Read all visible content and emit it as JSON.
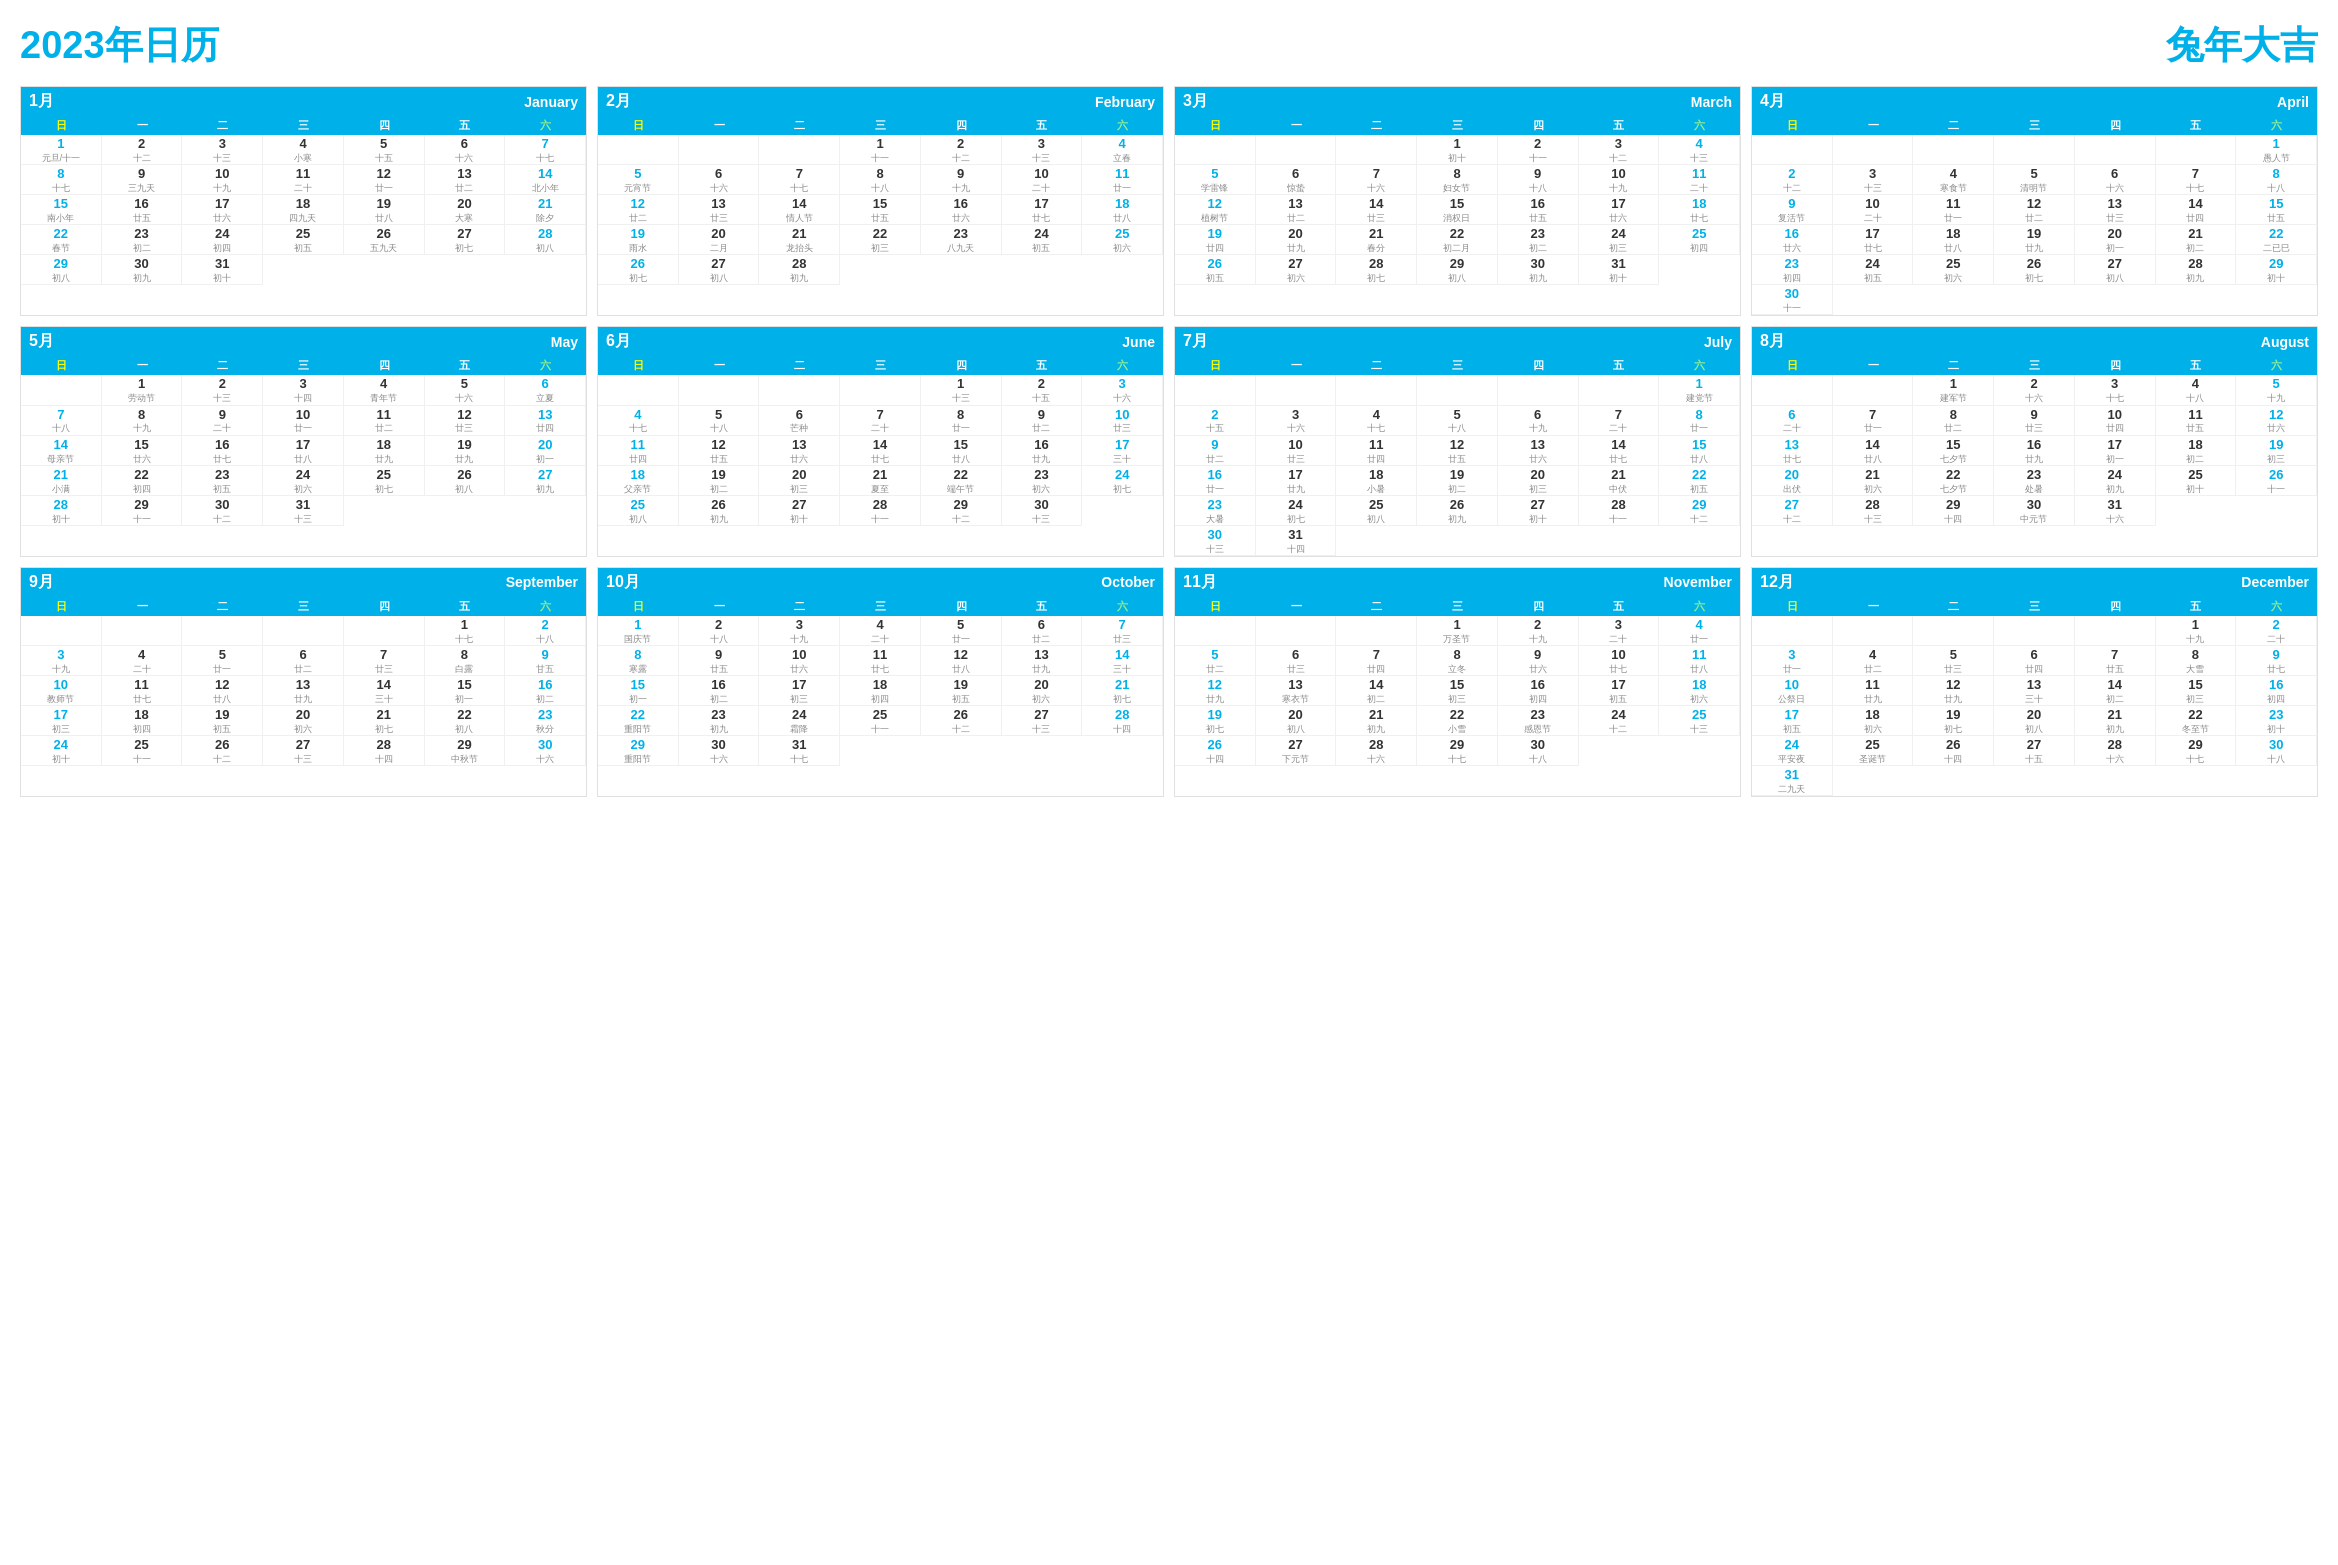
{
  "header": {
    "title": "2023年日历",
    "subtitle": "兔年大吉"
  },
  "weekdays": [
    "日",
    "一",
    "二",
    "三",
    "四",
    "五",
    "六"
  ],
  "months": [
    {
      "cn": "1月",
      "en": "January",
      "startDay": 0,
      "days": 31,
      "lunar": {
        "1": "元旦/十一",
        "2": "十二",
        "3": "十三",
        "4": "小寒",
        "5": "十五",
        "6": "十六",
        "7": "十七",
        "8": "十七",
        "9": "三九天",
        "10": "十九",
        "11": "二十",
        "12": "廿一",
        "13": "廿二",
        "14": "北小年",
        "15": "南小年",
        "16": "廿五",
        "17": "廿六",
        "18": "四九天",
        "19": "廿八",
        "20": "大寒",
        "21": "除夕",
        "22": "春节",
        "23": "初二",
        "24": "初四",
        "25": "初五",
        "26": "五九天",
        "27": "初七",
        "28": "初八",
        "29": "初八",
        "30": "初九",
        "31": "初十"
      },
      "sundays": [
        1,
        8,
        15,
        22,
        29
      ],
      "saturdays": [
        7,
        14,
        21,
        28
      ]
    },
    {
      "cn": "2月",
      "en": "February",
      "startDay": 3,
      "days": 28,
      "lunar": {
        "1": "十一",
        "2": "十二",
        "3": "十三",
        "4": "立春",
        "5": "元宵节",
        "6": "十六",
        "7": "十七",
        "8": "十八",
        "9": "十九",
        "10": "二十",
        "11": "廿一",
        "12": "廿二",
        "13": "廿三",
        "14": "情人节",
        "15": "廿五",
        "16": "廿六",
        "17": "廿七",
        "18": "廿八",
        "19": "雨水",
        "20": "二月",
        "21": "龙抬头",
        "22": "初三",
        "23": "八九天",
        "24": "初五",
        "25": "初六",
        "26": "初七",
        "27": "初八",
        "28": "初九"
      },
      "sundays": [
        5,
        12,
        19,
        26
      ],
      "saturdays": [
        4,
        11,
        18,
        25
      ]
    },
    {
      "cn": "3月",
      "en": "March",
      "startDay": 3,
      "days": 31,
      "lunar": {
        "1": "初十",
        "2": "十一",
        "3": "十二",
        "4": "十三",
        "5": "学雷锋",
        "6": "惊蛰",
        "7": "十六",
        "8": "妇女节",
        "9": "十八",
        "10": "十九",
        "11": "二十",
        "12": "植树节",
        "13": "廿二",
        "14": "廿三",
        "15": "消权日",
        "16": "廿五",
        "17": "廿六",
        "18": "廿七",
        "19": "廿四",
        "20": "廿九",
        "21": "春分",
        "22": "初二月",
        "23": "初二",
        "24": "初三",
        "25": "初四",
        "26": "初五",
        "27": "初六",
        "28": "初七",
        "29": "初八",
        "30": "初九",
        "31": "初十"
      },
      "sundays": [
        5,
        12,
        19,
        26
      ],
      "saturdays": [
        4,
        11,
        18,
        25
      ]
    },
    {
      "cn": "4月",
      "en": "April",
      "startDay": 6,
      "days": 30,
      "lunar": {
        "1": "愚人节",
        "2": "十二",
        "3": "十三",
        "4": "寒食节",
        "5": "清明节",
        "6": "十六",
        "7": "十七",
        "8": "十八",
        "9": "复活节",
        "10": "二十",
        "11": "廿一",
        "12": "廿二",
        "13": "廿三",
        "14": "廿四",
        "15": "廿五",
        "16": "廿六",
        "17": "廿七",
        "18": "廿八",
        "19": "廿九",
        "20": "初一",
        "21": "初二",
        "22": "二已巳",
        "23": "初四",
        "24": "初五",
        "25": "初六",
        "26": "初七",
        "27": "初八",
        "28": "初九",
        "29": "初十",
        "30": "十一"
      },
      "sundays": [
        2,
        9,
        16,
        23,
        30
      ],
      "saturdays": [
        1,
        8,
        15,
        22,
        29
      ]
    },
    {
      "cn": "5月",
      "en": "May",
      "startDay": 1,
      "days": 31,
      "lunar": {
        "1": "劳动节",
        "2": "十三",
        "3": "十四",
        "4": "青年节",
        "5": "十六",
        "6": "立夏",
        "7": "十八",
        "8": "十九",
        "9": "二十",
        "10": "廿一",
        "11": "廿二",
        "12": "廿三",
        "13": "廿四",
        "14": "母亲节",
        "15": "廿六",
        "16": "廿七",
        "17": "廿八",
        "18": "廿九",
        "19": "廿九",
        "20": "初一",
        "21": "小满",
        "22": "初四",
        "23": "初五",
        "24": "初六",
        "25": "初七",
        "26": "初八",
        "27": "初九",
        "28": "初十",
        "29": "十一",
        "30": "十二",
        "31": "十三"
      },
      "sundays": [
        7,
        14,
        21,
        28
      ],
      "saturdays": [
        6,
        13,
        20,
        27
      ]
    },
    {
      "cn": "6月",
      "en": "June",
      "startDay": 4,
      "days": 30,
      "lunar": {
        "1": "十三",
        "2": "十五",
        "3": "十六",
        "4": "十七",
        "5": "十八",
        "6": "芒种",
        "7": "二十",
        "8": "廿一",
        "9": "廿二",
        "10": "廿三",
        "11": "廿四",
        "12": "廿五",
        "13": "廿六",
        "14": "廿七",
        "15": "廿八",
        "16": "廿九",
        "17": "三十",
        "18": "父亲节",
        "19": "初二",
        "20": "初三",
        "21": "夏至",
        "22": "端午节",
        "23": "初六",
        "24": "初七",
        "25": "初八",
        "26": "初九",
        "27": "初十",
        "28": "十一",
        "29": "十二",
        "30": "十三"
      },
      "sundays": [
        4,
        11,
        18,
        25
      ],
      "saturdays": [
        3,
        10,
        17,
        24
      ]
    },
    {
      "cn": "7月",
      "en": "July",
      "startDay": 6,
      "days": 31,
      "lunar": {
        "1": "建党节",
        "2": "十五",
        "3": "十六",
        "4": "十七",
        "5": "十八",
        "6": "十九",
        "7": "二十",
        "8": "廿一",
        "9": "廿二",
        "10": "廿三",
        "11": "廿四",
        "12": "廿五",
        "13": "廿六",
        "14": "廿七",
        "15": "廿八",
        "16": "廿一",
        "17": "廿九",
        "18": "小暑",
        "19": "初二",
        "20": "初三",
        "21": "中伏",
        "22": "初五",
        "23": "大暑",
        "24": "初七",
        "25": "初八",
        "26": "初九",
        "27": "初十",
        "28": "十一",
        "29": "十二",
        "30": "十三",
        "31": "十四"
      },
      "sundays": [
        2,
        9,
        16,
        23,
        30
      ],
      "saturdays": [
        1,
        8,
        15,
        22,
        29
      ]
    },
    {
      "cn": "8月",
      "en": "August",
      "startDay": 2,
      "days": 31,
      "lunar": {
        "1": "建军节",
        "2": "十六",
        "3": "十七",
        "4": "十八",
        "5": "十九",
        "6": "二十",
        "7": "廿一",
        "8": "廿二",
        "9": "廿三",
        "10": "廿四",
        "11": "廿五",
        "12": "廿六",
        "13": "廿七",
        "14": "廿八",
        "15": "七夕节",
        "16": "廿九",
        "17": "初一",
        "18": "初二",
        "19": "初三",
        "20": "出伏",
        "21": "初六",
        "22": "七夕节",
        "23": "处暑",
        "24": "初九",
        "25": "初十",
        "26": "十一",
        "27": "十二",
        "28": "十三",
        "29": "十四",
        "30": "中元节",
        "31": "十六"
      },
      "sundays": [
        6,
        13,
        20,
        27
      ],
      "saturdays": [
        5,
        12,
        19,
        26
      ]
    },
    {
      "cn": "9月",
      "en": "September",
      "startDay": 5,
      "days": 30,
      "lunar": {
        "1": "十七",
        "2": "十八",
        "3": "十九",
        "4": "二十",
        "5": "廿一",
        "6": "廿二",
        "7": "廿三",
        "8": "白露",
        "9": "甘五",
        "10": "教师节",
        "11": "廿七",
        "12": "廿八",
        "13": "廿九",
        "14": "三十",
        "15": "初一",
        "16": "初二",
        "17": "初三",
        "18": "初四",
        "19": "初五",
        "20": "初六",
        "21": "初七",
        "22": "初八",
        "23": "秋分",
        "24": "初十",
        "25": "十一",
        "26": "十二",
        "27": "十三",
        "28": "十四",
        "29": "中秋节",
        "30": "十六"
      },
      "sundays": [
        3,
        10,
        17,
        24
      ],
      "saturdays": [
        2,
        9,
        16,
        23,
        30
      ]
    },
    {
      "cn": "10月",
      "en": "October",
      "startDay": 0,
      "days": 31,
      "lunar": {
        "1": "国庆节",
        "2": "十八",
        "3": "十九",
        "4": "二十",
        "5": "廿一",
        "6": "廿二",
        "7": "廿三",
        "8": "寒露",
        "9": "廿五",
        "10": "廿六",
        "11": "廿七",
        "12": "廿八",
        "13": "廿九",
        "14": "三十",
        "15": "初一",
        "16": "初二",
        "17": "初三",
        "18": "初四",
        "19": "初五",
        "20": "初六",
        "21": "初七",
        "22": "重阳节",
        "23": "初九",
        "24": "霜降",
        "25": "十一",
        "26": "十二",
        "27": "十三",
        "28": "十四",
        "29": "重阳节",
        "30": "十六",
        "31": "十七"
      },
      "sundays": [
        1,
        8,
        15,
        22,
        29
      ],
      "saturdays": [
        7,
        14,
        21,
        28
      ]
    },
    {
      "cn": "11月",
      "en": "November",
      "startDay": 3,
      "days": 30,
      "lunar": {
        "1": "万圣节",
        "2": "十九",
        "3": "二十",
        "4": "廿一",
        "5": "廿二",
        "6": "廿三",
        "7": "廿四",
        "8": "立冬",
        "9": "廿六",
        "10": "廿七",
        "11": "廿八",
        "12": "廿九",
        "13": "寒衣节",
        "14": "初二",
        "15": "初三",
        "16": "初四",
        "17": "初五",
        "18": "初六",
        "19": "初七",
        "20": "初八",
        "21": "初九",
        "22": "小雪",
        "23": "感恩节",
        "24": "十二",
        "25": "十三",
        "26": "十四",
        "27": "下元节",
        "28": "十六",
        "29": "十七",
        "30": "十八"
      },
      "sundays": [
        5,
        12,
        19,
        26
      ],
      "saturdays": [
        4,
        11,
        18,
        25
      ]
    },
    {
      "cn": "12月",
      "en": "December",
      "startDay": 5,
      "days": 31,
      "lunar": {
        "1": "十九",
        "2": "二十",
        "3": "廿一",
        "4": "廿二",
        "5": "廿三",
        "6": "廿四",
        "7": "廿五",
        "8": "大雪",
        "9": "廿七",
        "10": "公祭日",
        "11": "廿九",
        "12": "廿九",
        "13": "三十",
        "14": "初二",
        "15": "初三",
        "16": "初四",
        "17": "初五",
        "18": "初六",
        "19": "初七",
        "20": "初八",
        "21": "初九",
        "22": "冬至节",
        "23": "初十",
        "24": "平安夜",
        "25": "圣诞节",
        "26": "十四",
        "27": "十五",
        "28": "十六",
        "29": "十七",
        "30": "十八",
        "31": "二九天"
      },
      "sundays": [
        3,
        10,
        17,
        24,
        31
      ],
      "saturdays": [
        2,
        9,
        16,
        23,
        30
      ]
    }
  ]
}
